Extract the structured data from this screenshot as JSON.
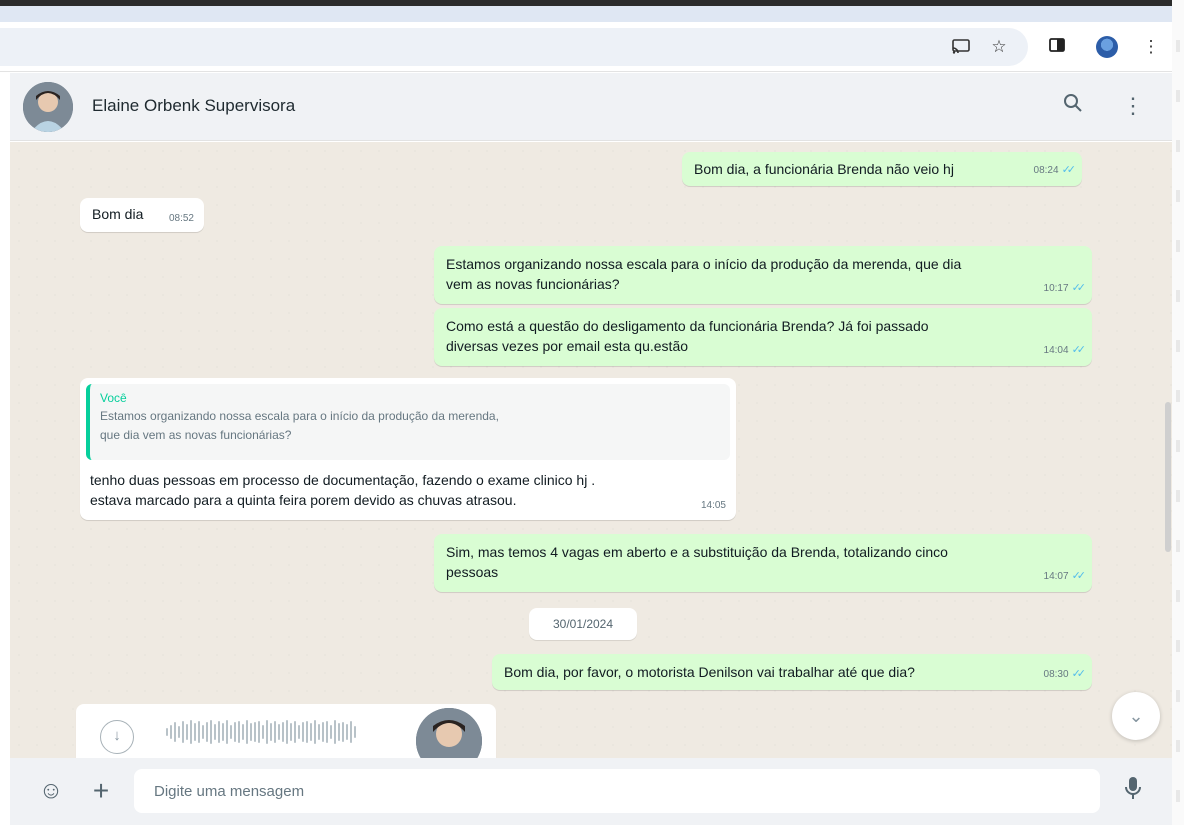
{
  "browser": {
    "icons": [
      "cast-icon",
      "star-icon",
      "sidebar-icon",
      "profile-icon",
      "more-vert-icon"
    ]
  },
  "header": {
    "contact_name": "Elaine Orbenk Supervisora"
  },
  "messages": [
    {
      "dir": "out",
      "text": "Bom dia, a funcionária Brenda não veio hj",
      "time": "08:24",
      "ticks": "✓✓"
    },
    {
      "dir": "in",
      "text": "Bom dia",
      "time": "08:52"
    },
    {
      "dir": "out",
      "line1": "Estamos organizando nossa escala para o início da produção da merenda, que dia",
      "line2": "vem as novas funcionárias?",
      "time": "10:17",
      "ticks": "✓✓"
    },
    {
      "dir": "out",
      "line1": "Como está a questão do desligamento da funcionária Brenda? Já foi passado",
      "line2": "diversas vezes por email esta qu.estão",
      "time": "14:04",
      "ticks": "✓✓"
    },
    {
      "dir": "in",
      "quote_author": "Você",
      "quote_line1": "Estamos organizando nossa escala para o início da produção da merenda,",
      "quote_line2": "que dia vem as novas funcionárias?",
      "line1": "tenho duas pessoas em processo de documentação, fazendo o exame clinico hj .",
      "line2": "estava marcado para a quinta feira porem devido as chuvas atrasou.",
      "time": "14:05"
    },
    {
      "dir": "out",
      "line1": "Sim, mas temos 4 vagas em aberto e a substituição da Brenda, totalizando cinco",
      "line2": "pessoas",
      "time": "14:07",
      "ticks": "✓✓"
    },
    {
      "dir": "out",
      "text": "Bom dia, por favor, o motorista Denilson vai trabalhar até que dia?",
      "time": "08:30",
      "ticks": "✓✓"
    }
  ],
  "date_divider": "30/01/2024",
  "composer": {
    "placeholder": "Digite uma mensagem",
    "emoji_icon": "☺",
    "attach_icon": "+",
    "mic_icon": "mic-icon"
  },
  "colors": {
    "outgoing_bubble": "#d9fdd3",
    "incoming_bubble": "#ffffff",
    "chat_background": "#efeae2",
    "read_ticks": "#53bdeb",
    "quote_accent": "#06cf9c"
  }
}
